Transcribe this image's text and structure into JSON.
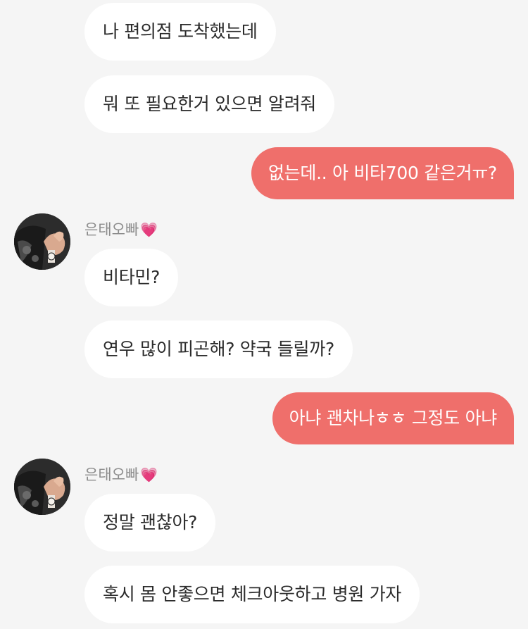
{
  "contact": {
    "name": "은태오빠",
    "heart": "💗",
    "avatar_icon": "couple-holding-hands-photo"
  },
  "messages": [
    {
      "from": "them",
      "text": "나 편의점 도착했는데"
    },
    {
      "from": "them",
      "text": "뭐 또 필요한거 있으면 알려줘"
    },
    {
      "from": "me",
      "text": "없는데.. 아 비타700 같은거ㅠ?"
    },
    {
      "from": "them",
      "text": "비타민?"
    },
    {
      "from": "them",
      "text": "연우 많이 피곤해? 약국 들릴까?"
    },
    {
      "from": "me",
      "text": "아냐 괜차나ㅎㅎ 그정도 아냐"
    },
    {
      "from": "them",
      "text": "정말 괜찮아?"
    },
    {
      "from": "them",
      "text": "혹시 몸 안좋으면 체크아웃하고 병원 가자"
    }
  ],
  "colors": {
    "background": "#f5f5f5",
    "incoming_bubble": "#ffffff",
    "outgoing_bubble": "#ef6f6b",
    "sender_name": "#8c8c8c"
  }
}
